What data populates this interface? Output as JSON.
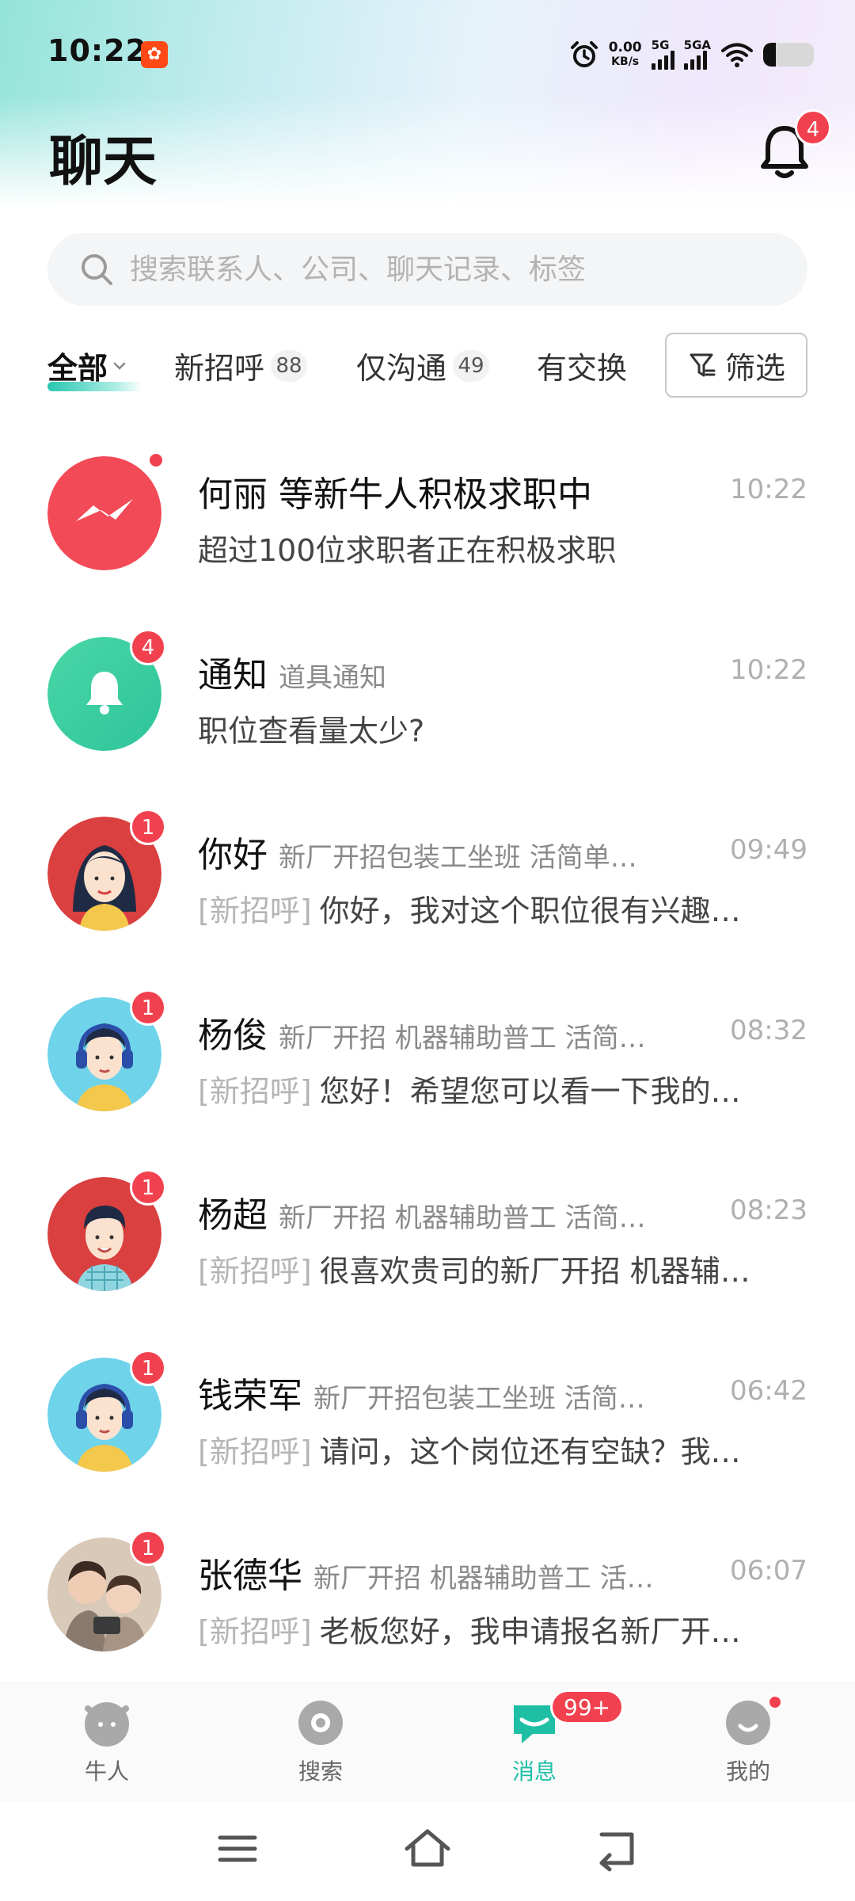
{
  "status_bar": {
    "time": "10:22",
    "net_speed_value": "0.00",
    "net_speed_unit": "KB/s",
    "signal1_label": "5G",
    "signal2_label": "5GA",
    "battery_level": 0.25
  },
  "header": {
    "title": "聊天",
    "notification_count": "4"
  },
  "search": {
    "placeholder": "搜索联系人、公司、聊天记录、标签"
  },
  "tabs": [
    {
      "label": "全部",
      "count": ""
    },
    {
      "label": "新招呼",
      "count": "88"
    },
    {
      "label": "仅沟通",
      "count": "49"
    },
    {
      "label": "有交换",
      "count": ""
    }
  ],
  "filter_label": "筛选",
  "chats": [
    {
      "name": "何丽 等新牛人积极求职中",
      "sub": "",
      "time": "10:22",
      "tag": "",
      "preview": "超过100位求职者正在积极求职",
      "badge": "",
      "avatar": "brand-red",
      "dot": true
    },
    {
      "name": "通知",
      "sub": "道具通知",
      "time": "10:22",
      "tag": "",
      "preview": "职位查看量太少?",
      "badge": "4",
      "avatar": "bell-green",
      "dot": false
    },
    {
      "name": "你好",
      "sub": "新厂开招包装工坐班 活简单…",
      "time": "09:49",
      "tag": "[新招呼]",
      "preview": "你好，我对这个职位很有兴趣…",
      "badge": "1",
      "avatar": "woman-red",
      "dot": false
    },
    {
      "name": "杨俊",
      "sub": "新厂开招 机器辅助普工 活简…",
      "time": "08:32",
      "tag": "[新招呼]",
      "preview": "您好！希望您可以看一下我的…",
      "badge": "1",
      "avatar": "man-headphones",
      "dot": false
    },
    {
      "name": "杨超",
      "sub": "新厂开招 机器辅助普工 活简…",
      "time": "08:23",
      "tag": "[新招呼]",
      "preview": "很喜欢贵司的新厂开招 机器辅…",
      "badge": "1",
      "avatar": "man-red",
      "dot": false
    },
    {
      "name": "钱荣军",
      "sub": "新厂开招包装工坐班 活简…",
      "time": "06:42",
      "tag": "[新招呼]",
      "preview": "请问，这个岗位还有空缺？我…",
      "badge": "1",
      "avatar": "man-headphones",
      "dot": false
    },
    {
      "name": "张德华",
      "sub": "新厂开招 机器辅助普工 活…",
      "time": "06:07",
      "tag": "[新招呼]",
      "preview": "老板您好，我申请报名新厂开…",
      "badge": "1",
      "avatar": "photo-kids",
      "dot": false
    }
  ],
  "bottom_nav": [
    {
      "label": "牛人",
      "icon": "cow-icon"
    },
    {
      "label": "搜索",
      "icon": "search-disc-icon"
    },
    {
      "label": "消息",
      "icon": "message-icon",
      "badge": "99+",
      "active": true
    },
    {
      "label": "我的",
      "icon": "profile-icon"
    }
  ],
  "colors": {
    "accent": "#1fbfa5",
    "badge": "#f2414e"
  }
}
